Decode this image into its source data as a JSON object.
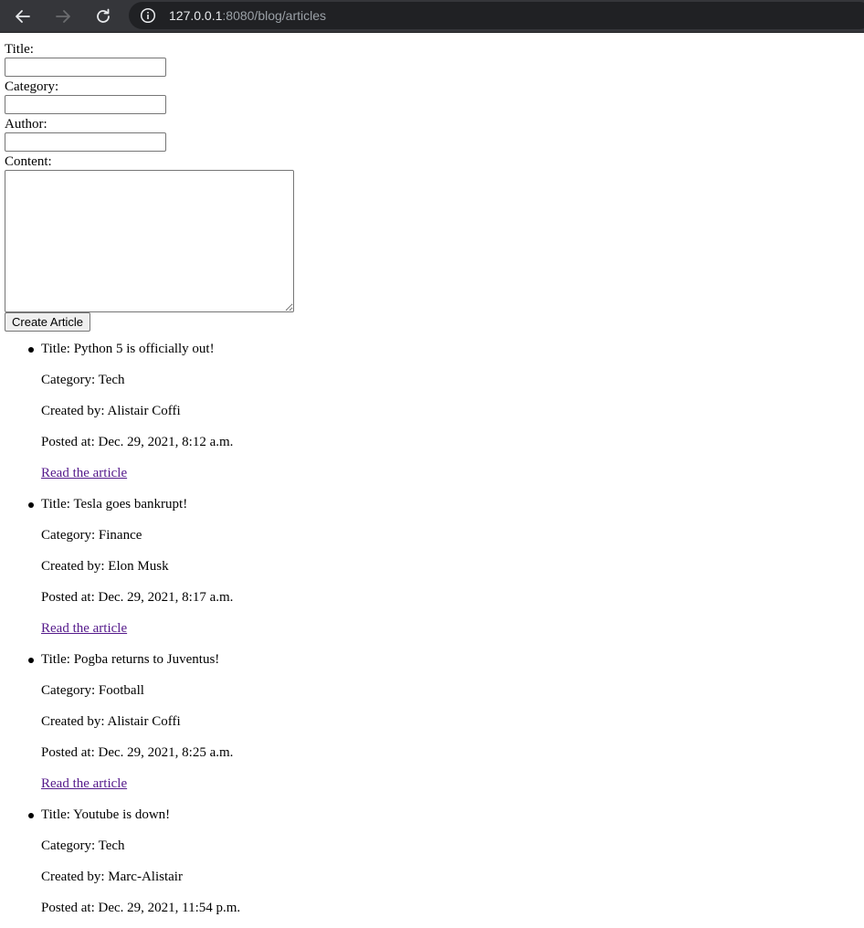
{
  "browser": {
    "url_host": "127.0.0.1",
    "url_rest": ":8080/blog/articles"
  },
  "form": {
    "title_label": "Title:",
    "category_label": "Category:",
    "author_label": "Author:",
    "content_label": "Content:",
    "title_value": "",
    "category_value": "",
    "author_value": "",
    "content_value": "",
    "submit_label": "Create Article"
  },
  "articles": [
    {
      "title": "Title: Python 5 is officially out!",
      "category": "Category: Tech",
      "author": "Created by: Alistair Coffi",
      "posted": "Posted at: Dec. 29, 2021, 8:12 a.m.",
      "link": "Read the article"
    },
    {
      "title": "Title: Tesla goes bankrupt!",
      "category": "Category: Finance",
      "author": "Created by: Elon Musk",
      "posted": "Posted at: Dec. 29, 2021, 8:17 a.m.",
      "link": "Read the article"
    },
    {
      "title": "Title: Pogba returns to Juventus!",
      "category": "Category: Football",
      "author": "Created by: Alistair Coffi",
      "posted": "Posted at: Dec. 29, 2021, 8:25 a.m.",
      "link": "Read the article"
    },
    {
      "title": "Title: Youtube is down!",
      "category": "Category: Tech",
      "author": "Created by: Marc-Alistair",
      "posted": "Posted at: Dec. 29, 2021, 11:54 p.m."
    }
  ],
  "icons": {
    "back": "back-arrow-icon",
    "forward": "forward-arrow-icon",
    "reload": "reload-icon",
    "info": "info-icon"
  },
  "colors": {
    "toolbar": "#35363a",
    "omnibox": "#202124",
    "visited_link": "#551a8b"
  }
}
